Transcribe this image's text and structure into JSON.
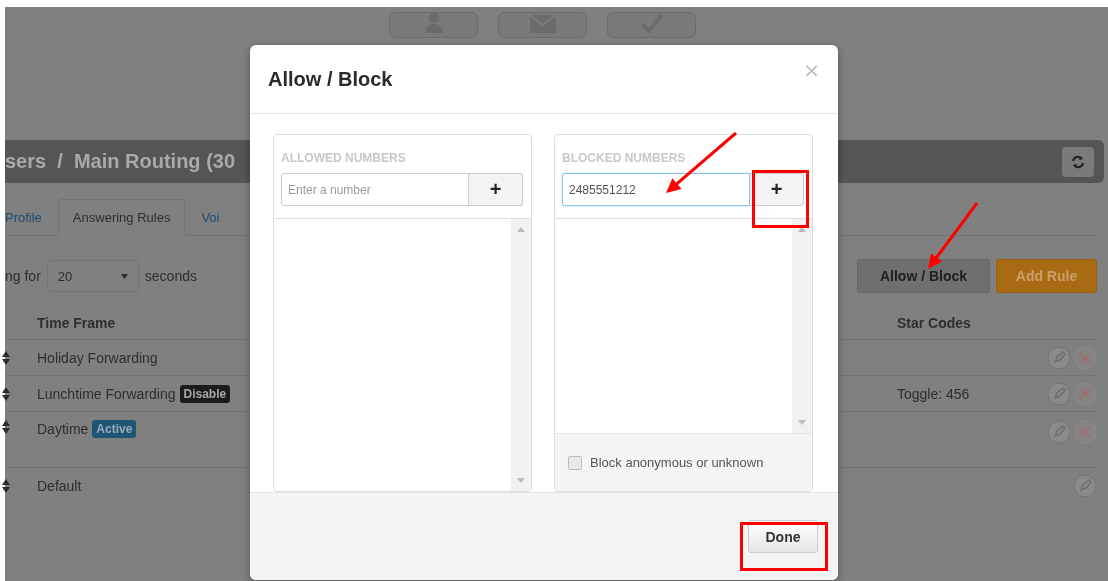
{
  "page": {
    "toolbar_buttons": [
      {
        "kind": "person"
      },
      {
        "kind": "envelope"
      },
      {
        "kind": "check"
      }
    ],
    "breadcrumb": "sers  /  Main Routing (30",
    "tabs": [
      {
        "label": "Profile",
        "selected": false
      },
      {
        "label": "Answering Rules",
        "selected": true
      },
      {
        "label": "Voi",
        "selected": false
      }
    ],
    "ring_label": "ng for",
    "ring_value": "20",
    "ring_unit": "seconds",
    "buttons": [
      {
        "label": "Allow / Block",
        "kind": "default"
      },
      {
        "label": "Add Rule",
        "kind": "primary"
      }
    ],
    "table": {
      "columns": [
        "Time Frame",
        "Star Codes"
      ],
      "rows": [
        {
          "time_frame": "Holiday Forwarding",
          "deletable": true
        },
        {
          "time_frame": "Lunchtime Forwarding",
          "badge": {
            "label": "Disable",
            "kind": "disabled"
          },
          "star_codes": "Toggle: 456",
          "deletable": true
        },
        {
          "time_frame": "Daytime",
          "badge": {
            "label": "Active",
            "kind": "active"
          },
          "deletable": true
        },
        {
          "time_frame": "Default",
          "deletable": false
        }
      ]
    }
  },
  "modal": {
    "title": "Allow / Block",
    "close": "×",
    "panels": [
      {
        "heading": "ALLOWED NUMBERS",
        "input": {
          "placeholder": "Enter a number",
          "focused": false
        },
        "add": "+"
      },
      {
        "heading": "BLOCKED NUMBERS",
        "input": {
          "value": "2485551212",
          "focused": true
        },
        "add": "+",
        "option": {
          "label": "Block anonymous or unknown",
          "checked": false
        }
      }
    ],
    "done": "Done"
  }
}
